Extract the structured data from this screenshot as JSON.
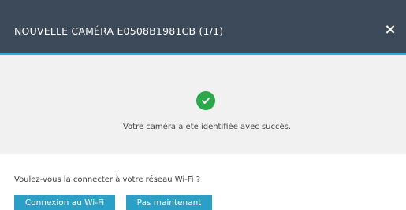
{
  "dialog": {
    "title": "NOUVELLE CAMÉRA E0508B1981CB (1/1)",
    "close_label": "×"
  },
  "success": {
    "icon": "check-circle-icon",
    "message": "Votre caméra a été identifiée avec succès."
  },
  "prompt": {
    "question": "Voulez-vous la connecter à votre réseau Wi-Fi ?"
  },
  "actions": {
    "wifi_label": "Connexion au Wi-Fi",
    "later_label": "Pas maintenant"
  },
  "colors": {
    "header": "#3c4a5a",
    "accent": "#2aa9d6",
    "button": "#2aa0c8",
    "success": "#2ba84a",
    "panel": "#f1f1f1"
  }
}
